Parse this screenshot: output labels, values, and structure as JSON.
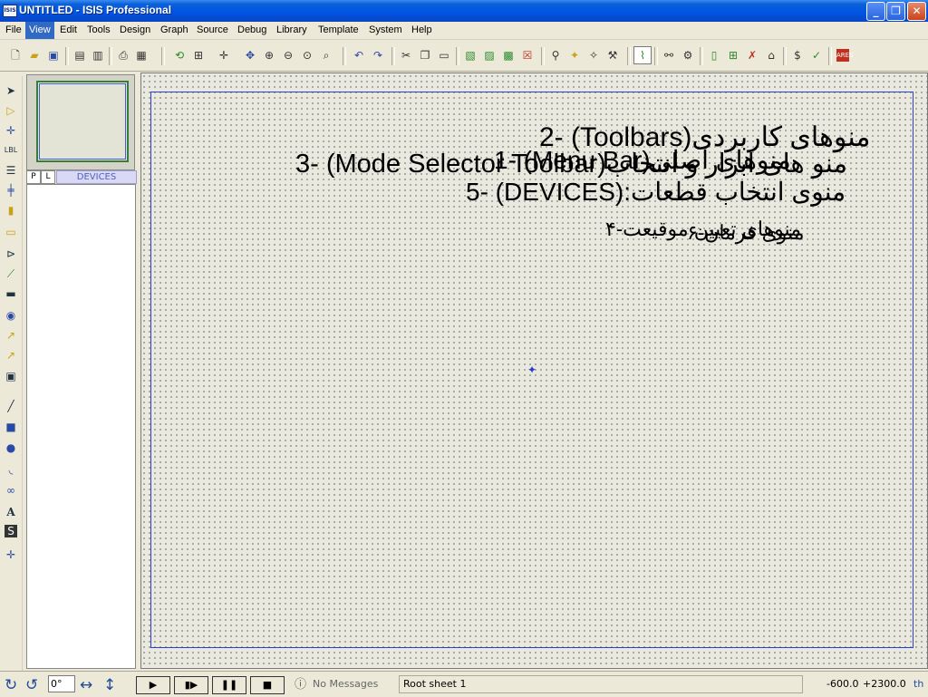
{
  "window": {
    "title": "UNTITLED - ISIS Professional",
    "app_icon": "ISIS"
  },
  "menu": [
    {
      "label": "File"
    },
    {
      "label": "View",
      "active": true
    },
    {
      "label": "Edit"
    },
    {
      "label": "Tools"
    },
    {
      "label": "Design"
    },
    {
      "label": "Graph"
    },
    {
      "label": "Source"
    },
    {
      "label": "Debug"
    },
    {
      "label": "Library"
    },
    {
      "label": "Template"
    },
    {
      "label": "System"
    },
    {
      "label": "Help"
    }
  ],
  "toolbar_icons": [
    "new-file-icon",
    "open-folder-icon",
    "save-icon",
    "import-icon",
    "export-icon",
    "print-icon",
    "print-area-icon",
    "refresh-icon",
    "grid-icon",
    "origin-icon",
    "pan-icon",
    "zoom-in-icon",
    "zoom-out-icon",
    "zoom-all-icon",
    "zoom-area-icon",
    "undo-icon",
    "redo-icon",
    "cut-icon",
    "copy-icon",
    "paste-icon",
    "block-copy-icon",
    "block-move-icon",
    "block-rotate-icon",
    "block-delete-icon",
    "pick-device-icon",
    "make-device-icon",
    "package-icon",
    "decompose-icon",
    "wire-autorouter-icon",
    "search-icon",
    "property-tool-icon",
    "new-sheet-icon",
    "add-sheet-icon",
    "remove-sheet-icon",
    "exit-parent-icon",
    "bom-icon",
    "erc-icon",
    "ares-icon"
  ],
  "mode_icons": [
    "selection-mode-icon",
    "component-mode-icon",
    "junction-dot-icon",
    "wire-label-icon",
    "text-script-icon",
    "bus-icon",
    "subcircuit-icon",
    "terminal-icon",
    "device-pin-icon",
    "graph-icon",
    "tape-recorder-icon",
    "generator-icon",
    "voltage-probe-icon",
    "current-probe-icon",
    "virtual-instrument-icon",
    "line-icon",
    "box-icon",
    "circle-icon",
    "arc-icon",
    "path-icon",
    "text-icon",
    "symbol-icon",
    "marker-icon"
  ],
  "device_panel": {
    "tab_p": "P",
    "tab_l": "L",
    "header": "DEVICES"
  },
  "annotations": {
    "toolbars": "2- (Toolbars)منوهای کاربردی",
    "menu_bar": "1- (Menu Bar)منوهای اصلی",
    "mode_selector": "3- (Mode Selector Toolbar)منو های ابزار و انتخاب",
    "devices": "5- (DEVICES):منوی انتخاب قطعات",
    "position": "۴-منوهای تعیین موقیعت",
    "position_b": "۶-منوی فرمان"
  },
  "status": {
    "angle": "0°",
    "messages": "No Messages",
    "sheet": "Root sheet 1",
    "x": "-600.0",
    "y": "+2300.0",
    "units": "th"
  },
  "colors": {
    "titlebar": "#0054e3",
    "menu_active": "#316ac5",
    "canvas_bg": "#e9e9df",
    "sheet_border": "#2c3fd0"
  }
}
